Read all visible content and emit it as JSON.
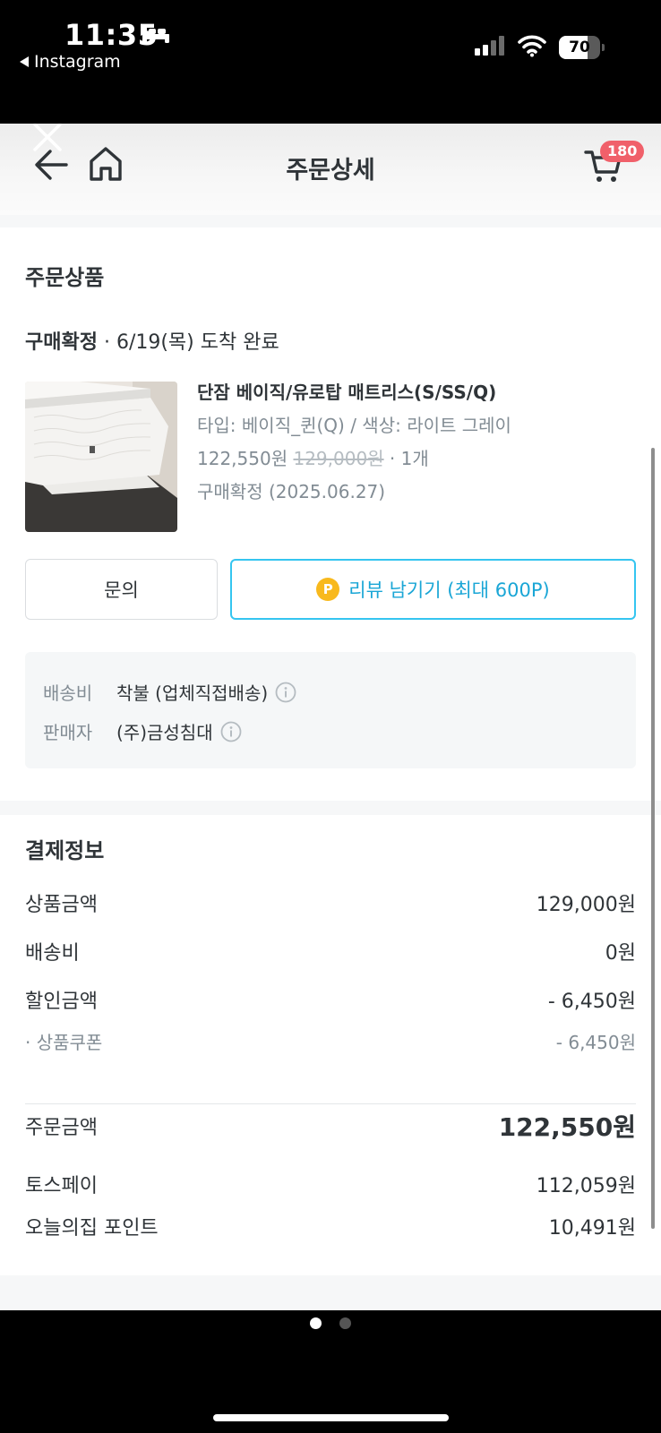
{
  "status_bar": {
    "time": "11:35",
    "back_app": "Instagram",
    "battery": "70",
    "battery_level": 0.7
  },
  "header": {
    "title": "주문상세",
    "cart_count": "180"
  },
  "order": {
    "section_title": "주문상품",
    "status_label": "구매확정",
    "status_detail": " · 6/19(목) 도착 완료",
    "product_name": "단잠 베이직/유로탑 매트리스(S/SS/Q)",
    "option": "타입: 베이직_퀸(Q) / 색상: 라이트 그레이",
    "price": "122,550원",
    "original_price": "129,000원",
    "quantity": " · 1개",
    "confirm_date": "구매확정 (2025.06.27)",
    "inquiry_button": "문의",
    "review_coin": "P",
    "review_button": "리뷰 남기기 (최대 600P)",
    "shipping_label": "배송비",
    "shipping_value": "착불 (업체직접배송)",
    "seller_label": "판매자",
    "seller_value": "(주)금성침대"
  },
  "payment": {
    "section_title": "결제정보",
    "rows": [
      {
        "label": "상품금액",
        "value": "129,000원"
      },
      {
        "label": "배송비",
        "value": "0원"
      },
      {
        "label": "할인금액",
        "value": "- 6,450원"
      },
      {
        "label": "· 상품쿠폰",
        "value": "- 6,450원"
      }
    ],
    "total_label": "주문금액",
    "total_value": "122,550원",
    "methods": [
      {
        "label": "토스페이",
        "value": "112,059원"
      },
      {
        "label": "오늘의집 포인트",
        "value": "10,491원"
      }
    ]
  },
  "colors": {
    "accent": "#35c5f0",
    "badge": "#f0606a",
    "coin": "#f8b91d"
  }
}
